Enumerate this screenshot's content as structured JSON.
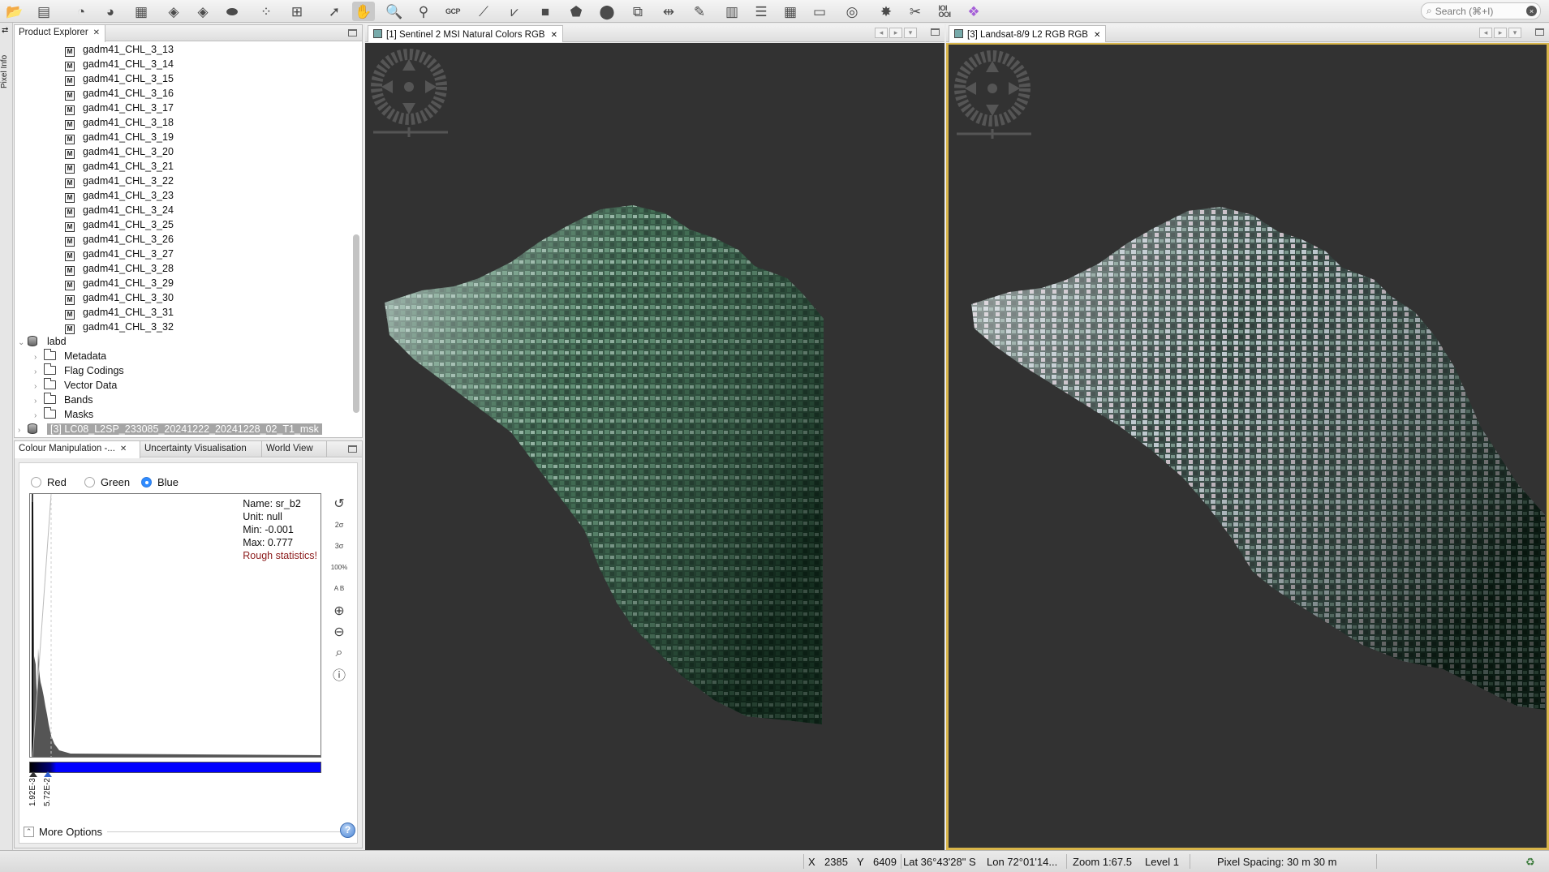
{
  "toolbar": {
    "gcp_label": "GCP",
    "binary_label": "IOI\nOOI",
    "search_placeholder": "Search (⌘+I)"
  },
  "left_strip": {
    "pixel_info_label": "Pixel Info"
  },
  "product_explorer": {
    "tab_label": "Product Explorer",
    "bands": [
      "gadm41_CHL_3_13",
      "gadm41_CHL_3_14",
      "gadm41_CHL_3_15",
      "gadm41_CHL_3_16",
      "gadm41_CHL_3_17",
      "gadm41_CHL_3_18",
      "gadm41_CHL_3_19",
      "gadm41_CHL_3_20",
      "gadm41_CHL_3_21",
      "gadm41_CHL_3_22",
      "gadm41_CHL_3_23",
      "gadm41_CHL_3_24",
      "gadm41_CHL_3_25",
      "gadm41_CHL_3_26",
      "gadm41_CHL_3_27",
      "gadm41_CHL_3_28",
      "gadm41_CHL_3_29",
      "gadm41_CHL_3_30",
      "gadm41_CHL_3_31",
      "gadm41_CHL_3_32"
    ],
    "product_node": "labd",
    "folders": [
      "Metadata",
      "Flag Codings",
      "Vector Data",
      "Bands",
      "Masks"
    ],
    "selected_product": "[3] LC08_L2SP_233085_20241222_20241228_02_T1_msk"
  },
  "tool_panel": {
    "tabs": [
      "Colour Manipulation -...",
      "Uncertainty Visualisation",
      "World View"
    ],
    "channels": [
      "Red",
      "Green",
      "Blue"
    ],
    "selected_channel": "Blue",
    "stats": {
      "name": "Name: sr_b2",
      "unit": "Unit: null",
      "min": "Min: -0.001",
      "max": "Max: 0.777",
      "warning": "Rough statistics!"
    },
    "slider_min_label": "1.92E-3",
    "slider_max_label": "5.72E-2",
    "tool_labels": [
      "2σ",
      "3σ",
      "100%",
      "A B"
    ],
    "more_options": "More Options"
  },
  "views": [
    {
      "tab_label": "[1] Sentinel 2 MSI Natural Colors RGB"
    },
    {
      "tab_label": "[3] Landsat-8/9 L2 RGB RGB"
    }
  ],
  "status": {
    "x_label": "X",
    "x_value": "2385",
    "y_label": "Y",
    "y_value": "6409",
    "lat": "Lat 36°43'28\" S",
    "lon": "Lon 72°01'14...",
    "zoom": "Zoom 1:67.5",
    "level": "Level 1",
    "pixel_spacing": "Pixel Spacing: 30 m 30 m"
  },
  "colors": {
    "focus_border": "#d8b54a",
    "canvas_bg": "#323232",
    "blue_channel": "#0000ff",
    "warning_text": "#8b1a1a"
  }
}
